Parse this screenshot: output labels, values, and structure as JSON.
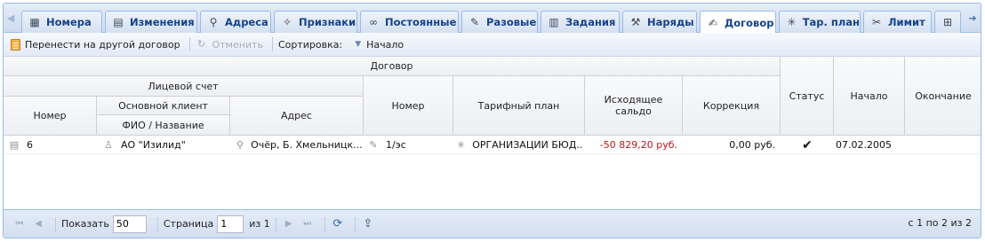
{
  "tabs": [
    {
      "label": "Номера",
      "icon": "calendar-icon",
      "glyph": "▦"
    },
    {
      "label": "Изменения",
      "icon": "document-icon",
      "glyph": "▤"
    },
    {
      "label": "Адреса",
      "icon": "map-pin-icon",
      "glyph": "⚲"
    },
    {
      "label": "Признаки",
      "icon": "magic-wand-icon",
      "glyph": "✧"
    },
    {
      "label": "Постоянные",
      "icon": "link-icon",
      "glyph": "∞"
    },
    {
      "label": "Разовые",
      "icon": "wrench-icon",
      "glyph": "✎"
    },
    {
      "label": "Задания",
      "icon": "notebook-icon",
      "glyph": "▥"
    },
    {
      "label": "Наряды",
      "icon": "tools-icon",
      "glyph": "⚒"
    },
    {
      "label": "Договор",
      "icon": "contract-icon",
      "glyph": "✍"
    },
    {
      "label": "Тар. план",
      "icon": "network-icon",
      "glyph": "✳"
    },
    {
      "label": "Лимит",
      "icon": "scissors-icon",
      "glyph": "✂"
    },
    {
      "label": "",
      "icon": "grid-icon",
      "glyph": "⊞"
    }
  ],
  "active_tab": "Договор",
  "toolbar": {
    "move_label": "Перенести на другой договор",
    "undo_label": "Отменить",
    "sort_label": "Сортировка:",
    "sort_value": "Начало"
  },
  "columns": {
    "contract_group": "Договор",
    "account_group": "Лицевой счет",
    "number": "Номер",
    "main_client": "Основной клиент",
    "client_name": "ФИО / Название",
    "address": "Адрес",
    "contract_number": "Номер",
    "tariff_plan": "Тарифный план",
    "outgoing_balance": "Исходящее сальдо",
    "correction": "Коррекция",
    "status": "Статус",
    "start": "Начало",
    "end": "Окончание"
  },
  "rows": [
    {
      "number": "6",
      "client": "АО \"Изилид\"",
      "address": "Очёр, Б. Хмельницк...",
      "contract_number": "1/эс",
      "tariff_plan": "ОРГАНИЗАЦИИ БЮД...",
      "outgoing_balance": "-50 829,20 руб.",
      "correction": "0,00 руб.",
      "status": "✔",
      "start": "07.02.2005",
      "end": ""
    }
  ],
  "pager": {
    "show_label": "Показать",
    "page_size": "50",
    "page_label": "Страница",
    "page": "1",
    "of_label": "из 1",
    "info": "с 1 по 2 из 2"
  },
  "colors": {
    "accent": "#15428b",
    "border": "#99bbe8",
    "negative": "#c0151b"
  }
}
